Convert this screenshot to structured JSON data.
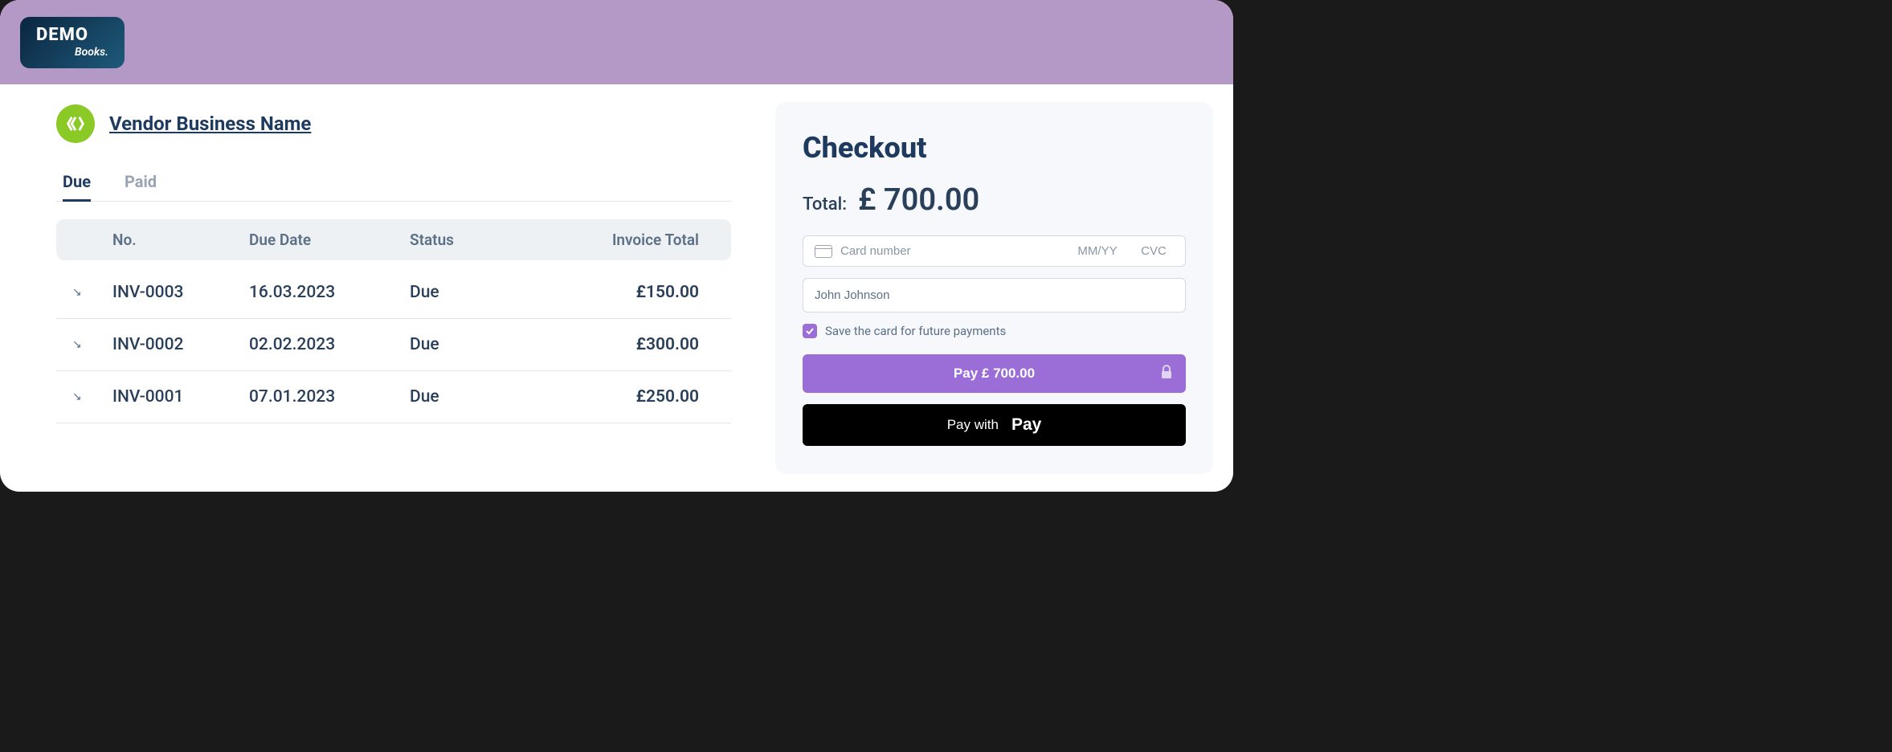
{
  "logo": {
    "line1": "DEMO",
    "line2": "Books."
  },
  "vendor": {
    "name": "Vendor Business Name"
  },
  "tabs": {
    "due": "Due",
    "paid": "Paid"
  },
  "table": {
    "headers": {
      "no": "No.",
      "dueDate": "Due Date",
      "status": "Status",
      "total": "Invoice Total"
    },
    "rows": [
      {
        "no": "INV-0003",
        "dueDate": "16.03.2023",
        "status": "Due",
        "total": "£150.00"
      },
      {
        "no": "INV-0002",
        "dueDate": "02.02.2023",
        "status": "Due",
        "total": "£300.00"
      },
      {
        "no": "INV-0001",
        "dueDate": "07.01.2023",
        "status": "Due",
        "total": "£250.00"
      }
    ]
  },
  "checkout": {
    "title": "Checkout",
    "totalLabel": "Total:",
    "totalAmount": "£ 700.00",
    "cardNumberPlaceholder": "Card number",
    "mmYYPlaceholder": "MM/YY",
    "cvcPlaceholder": "CVC",
    "nameValue": "John Johnson",
    "saveCardLabel": "Save the card for future payments",
    "payButtonLabel": "Pay £ 700.00",
    "applePayPrefix": "Pay with",
    "applePayText": "Pay"
  }
}
